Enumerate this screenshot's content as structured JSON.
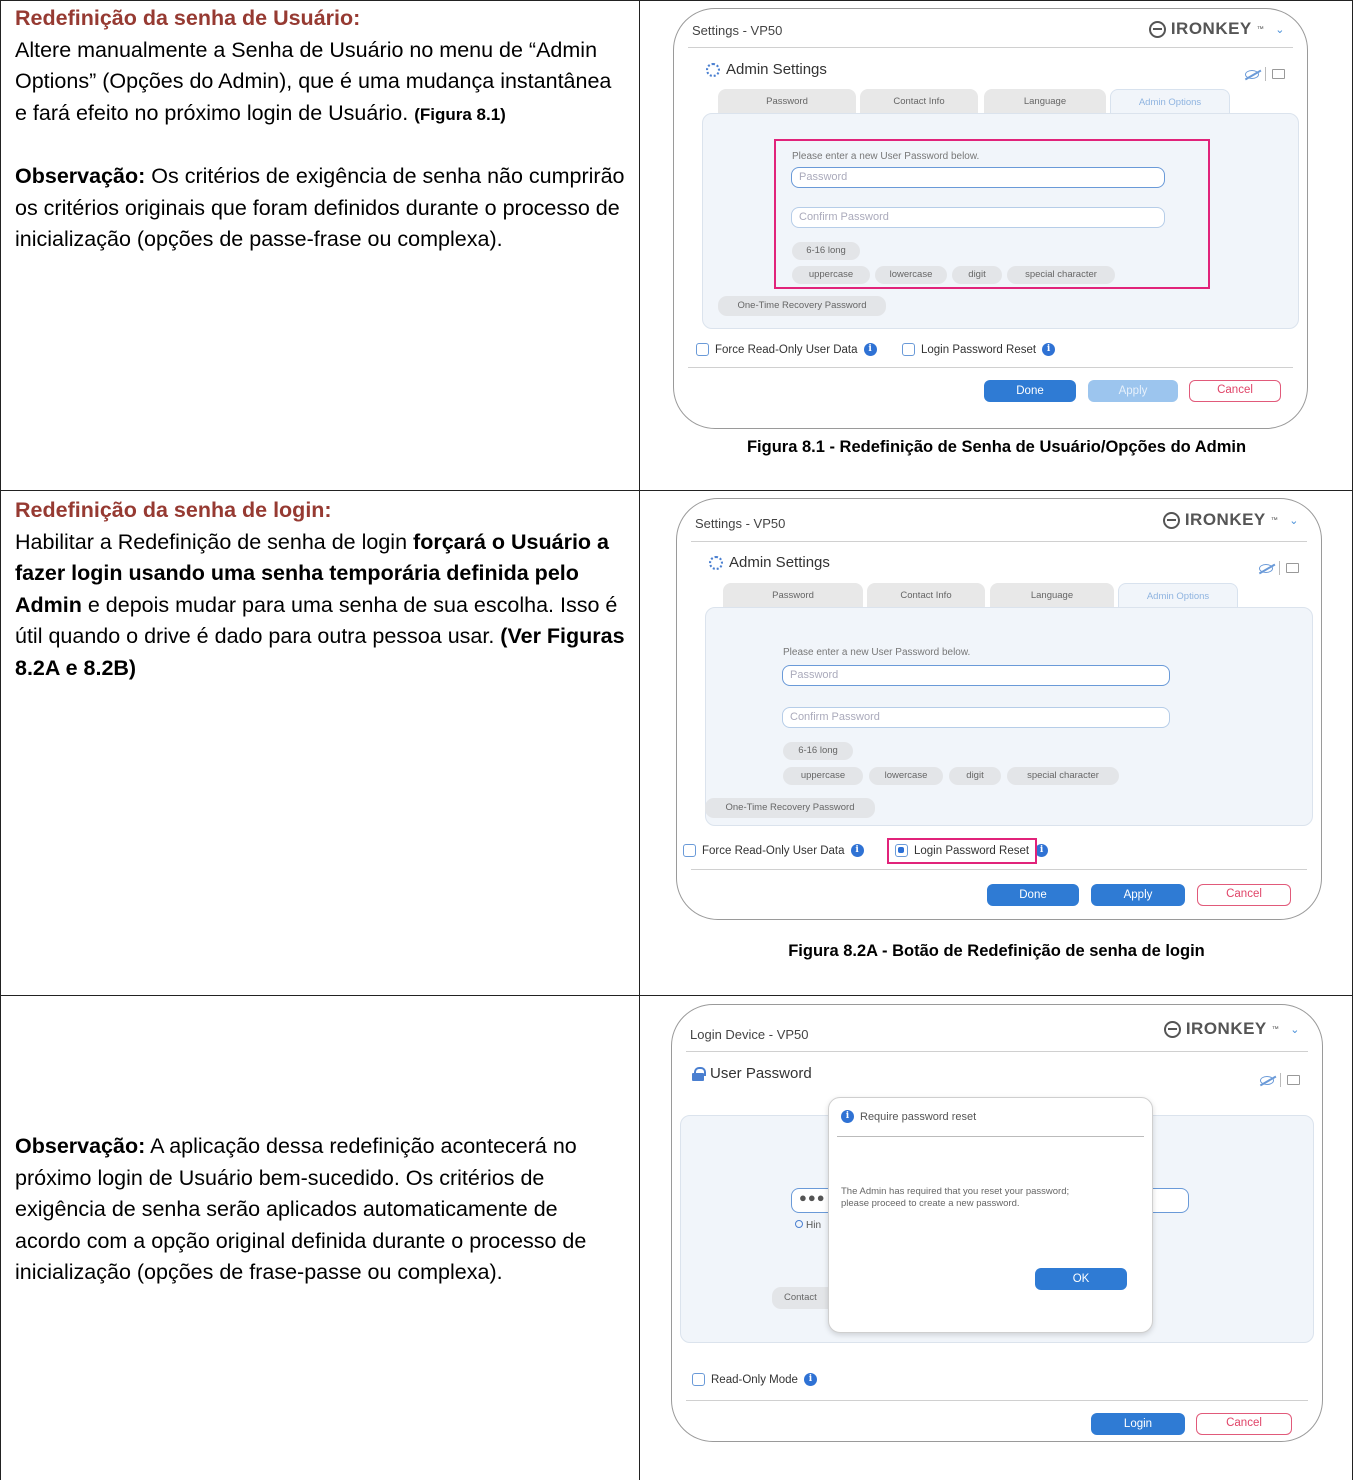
{
  "rows": [
    {
      "heading": "Redefinição da senha de Usuário:",
      "p1": "Altere manualmente a Senha de Usuário no menu de “Admin Options” (Opções do Admin), que é uma mudança instantânea e fará efeito no próximo login de Usuário.",
      "p1_ref": "(Figura 8.1)",
      "note_label": "Observação:",
      "note_text": "Os critérios de exigência de senha não cumprirão os critérios originais que foram definidos durante o processo de inicialização (opções de passe-frase ou complexa).",
      "caption": "Figura 8.1 - Redefinição de Senha de Usuário/Opções do Admin"
    },
    {
      "heading": "Redefinição da senha de login:",
      "p_start": "Habilitar a Redefinição de senha de login",
      "p_bold": "forçará o Usuário a fazer login usando uma senha temporária definida pelo Admin",
      "p_end": "e depois mudar para uma senha de sua escolha. Isso é útil quando o drive é dado para outra pessoa usar.",
      "p_ref": "(Ver Figuras 8.2A e 8.2B)",
      "caption": "Figura 8.2A - Botão de Redefinição de senha de login"
    },
    {
      "note_label": "Observação:",
      "note_text": "A aplicação dessa redefinição acontecerá no próximo login de Usuário bem-sucedido. Os critérios de exigência de senha serão aplicados automaticamente de acordo com a opção original definida durante o processo de inicialização (opções de frase-passe ou complexa)."
    }
  ],
  "settings_window": {
    "title": "Settings - VP50",
    "brand": "IRONKEY",
    "brand_mark": "™",
    "section": "Admin Settings",
    "tabs": [
      "Password",
      "Contact Info",
      "Language",
      "Admin Options"
    ],
    "active_tab": "Admin Options",
    "prompt": "Please enter a new User Password below.",
    "password_placeholder": "Password",
    "confirm_placeholder": "Confirm Password",
    "criteria": [
      "6-16 long",
      "uppercase",
      "lowercase",
      "digit",
      "special character"
    ],
    "recovery_button": "One-Time Recovery Password",
    "force_readonly": "Force Read-Only User Data",
    "login_reset": "Login Password Reset",
    "done": "Done",
    "apply": "Apply",
    "cancel": "Cancel"
  },
  "login_window": {
    "title": "Login Device - VP50",
    "brand": "IRONKEY",
    "brand_mark": "™",
    "section": "User Password",
    "masked_value": "●●●",
    "hint_partial": "Hin",
    "contact_partial": "Contact",
    "modal_title": "Require password reset",
    "modal_message_1": "The Admin has required that you reset your password;",
    "modal_message_2": "please proceed to create a new password.",
    "ok": "OK",
    "readonly_mode": "Read-Only Mode",
    "login": "Login",
    "cancel": "Cancel"
  },
  "colors": {
    "heading": "#963a32",
    "highlight": "#e1237a",
    "primary_button": "#2f7bd4",
    "cancel_border": "#e15a7a"
  }
}
